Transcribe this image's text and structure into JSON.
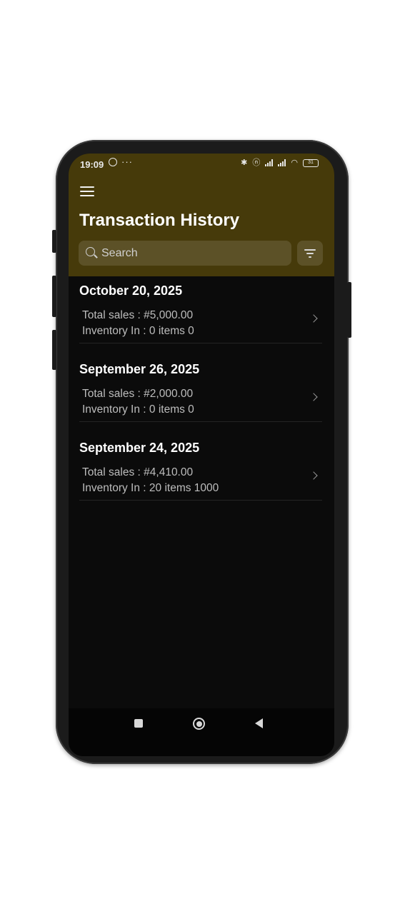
{
  "status_bar": {
    "time": "19:09",
    "more_indicator": "···",
    "battery": "31",
    "icons": [
      "whatsapp-icon",
      "bluetooth-icon",
      "nfc-icon",
      "signal-icon",
      "signal-icon",
      "wifi-icon",
      "battery-icon"
    ]
  },
  "header": {
    "title": "Transaction History",
    "search": {
      "placeholder": "Search",
      "value": ""
    },
    "background_color": "#463a0a"
  },
  "transactions": [
    {
      "date": "October 20, 2025",
      "total_sales": "Total sales : #5,000.00",
      "inventory": "Inventory In : 0 items  0"
    },
    {
      "date": "September 26, 2025",
      "total_sales": "Total sales : #2,000.00",
      "inventory": "Inventory In : 0 items  0"
    },
    {
      "date": "September 24, 2025",
      "total_sales": "Total sales : #4,410.00",
      "inventory": "Inventory In : 20 items  1000"
    }
  ],
  "nav_bar": {
    "icons": [
      "recents-icon",
      "home-icon",
      "back-icon"
    ]
  }
}
